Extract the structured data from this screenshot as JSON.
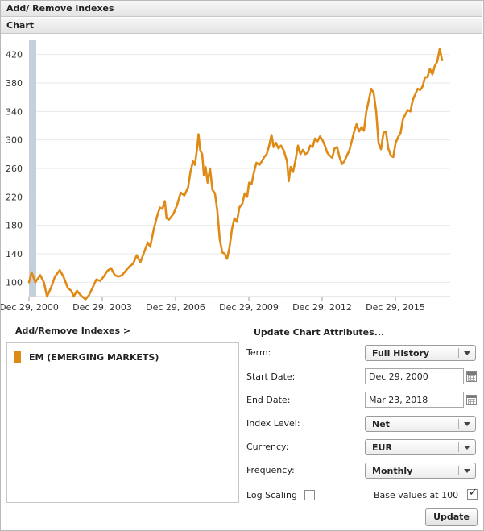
{
  "panel_title": "Add/ Remove indexes",
  "chart_header": "Chart",
  "colors": {
    "series": "#e08a16",
    "left_band": "#c4d0db",
    "grid": "#e9e9e9"
  },
  "chart_data": {
    "type": "line",
    "title": "",
    "xlabel": "",
    "ylabel": "",
    "ylim": [
      80,
      440
    ],
    "yticks": [
      100,
      140,
      180,
      220,
      260,
      300,
      340,
      380,
      420
    ],
    "xlim": [
      2000.99,
      2018.23
    ],
    "xticks": [
      {
        "pos": 2000.99,
        "label": "Dec 29, 2000"
      },
      {
        "pos": 2003.99,
        "label": "Dec 29, 2003"
      },
      {
        "pos": 2006.99,
        "label": "Dec 29, 2006"
      },
      {
        "pos": 2009.99,
        "label": "Dec 29, 2009"
      },
      {
        "pos": 2012.99,
        "label": "Dec 29, 2012"
      },
      {
        "pos": 2015.99,
        "label": "Dec 29, 2015"
      }
    ],
    "grid": true,
    "legend": "left",
    "series": [
      {
        "name": "EM (EMERGING MARKETS)",
        "points": [
          [
            2000.99,
            100
          ],
          [
            2001.1,
            114
          ],
          [
            2001.25,
            100
          ],
          [
            2001.45,
            110
          ],
          [
            2001.6,
            100
          ],
          [
            2001.73,
            80
          ],
          [
            2001.9,
            93
          ],
          [
            2002.05,
            108
          ],
          [
            2002.25,
            117
          ],
          [
            2002.4,
            108
          ],
          [
            2002.58,
            92
          ],
          [
            2002.72,
            88
          ],
          [
            2002.82,
            80
          ],
          [
            2002.95,
            88
          ],
          [
            2003.1,
            82
          ],
          [
            2003.3,
            76
          ],
          [
            2003.45,
            82
          ],
          [
            2003.6,
            93
          ],
          [
            2003.75,
            104
          ],
          [
            2003.9,
            102
          ],
          [
            2004.05,
            108
          ],
          [
            2004.2,
            116
          ],
          [
            2004.35,
            120
          ],
          [
            2004.5,
            110
          ],
          [
            2004.65,
            108
          ],
          [
            2004.8,
            110
          ],
          [
            2004.95,
            116
          ],
          [
            2005.1,
            122
          ],
          [
            2005.25,
            126
          ],
          [
            2005.4,
            138
          ],
          [
            2005.55,
            128
          ],
          [
            2005.7,
            142
          ],
          [
            2005.85,
            156
          ],
          [
            2005.95,
            150
          ],
          [
            2006.1,
            175
          ],
          [
            2006.25,
            195
          ],
          [
            2006.35,
            205
          ],
          [
            2006.45,
            203
          ],
          [
            2006.55,
            214
          ],
          [
            2006.62,
            190
          ],
          [
            2006.72,
            188
          ],
          [
            2006.9,
            196
          ],
          [
            2007.05,
            208
          ],
          [
            2007.2,
            226
          ],
          [
            2007.35,
            222
          ],
          [
            2007.5,
            233
          ],
          [
            2007.6,
            255
          ],
          [
            2007.7,
            270
          ],
          [
            2007.78,
            265
          ],
          [
            2007.88,
            290
          ],
          [
            2007.93,
            308
          ],
          [
            2008.0,
            285
          ],
          [
            2008.08,
            280
          ],
          [
            2008.15,
            250
          ],
          [
            2008.22,
            262
          ],
          [
            2008.3,
            240
          ],
          [
            2008.4,
            260
          ],
          [
            2008.5,
            230
          ],
          [
            2008.6,
            225
          ],
          [
            2008.7,
            200
          ],
          [
            2008.8,
            160
          ],
          [
            2008.9,
            142
          ],
          [
            2009.0,
            140
          ],
          [
            2009.1,
            133
          ],
          [
            2009.2,
            150
          ],
          [
            2009.3,
            175
          ],
          [
            2009.4,
            190
          ],
          [
            2009.5,
            185
          ],
          [
            2009.6,
            205
          ],
          [
            2009.72,
            210
          ],
          [
            2009.82,
            225
          ],
          [
            2009.92,
            220
          ],
          [
            2010.0,
            240
          ],
          [
            2010.1,
            238
          ],
          [
            2010.2,
            255
          ],
          [
            2010.3,
            268
          ],
          [
            2010.42,
            265
          ],
          [
            2010.52,
            270
          ],
          [
            2010.62,
            276
          ],
          [
            2010.72,
            280
          ],
          [
            2010.82,
            292
          ],
          [
            2010.92,
            307
          ],
          [
            2011.0,
            290
          ],
          [
            2011.1,
            296
          ],
          [
            2011.2,
            288
          ],
          [
            2011.3,
            292
          ],
          [
            2011.42,
            285
          ],
          [
            2011.55,
            270
          ],
          [
            2011.62,
            242
          ],
          [
            2011.7,
            262
          ],
          [
            2011.8,
            255
          ],
          [
            2011.9,
            272
          ],
          [
            2012.0,
            292
          ],
          [
            2012.1,
            280
          ],
          [
            2012.2,
            286
          ],
          [
            2012.3,
            280
          ],
          [
            2012.4,
            282
          ],
          [
            2012.5,
            292
          ],
          [
            2012.6,
            290
          ],
          [
            2012.7,
            302
          ],
          [
            2012.8,
            298
          ],
          [
            2012.9,
            305
          ],
          [
            2013.0,
            300
          ],
          [
            2013.1,
            292
          ],
          [
            2013.2,
            282
          ],
          [
            2013.3,
            278
          ],
          [
            2013.4,
            275
          ],
          [
            2013.5,
            288
          ],
          [
            2013.6,
            290
          ],
          [
            2013.7,
            276
          ],
          [
            2013.8,
            266
          ],
          [
            2013.9,
            270
          ],
          [
            2014.0,
            278
          ],
          [
            2014.1,
            285
          ],
          [
            2014.2,
            298
          ],
          [
            2014.3,
            312
          ],
          [
            2014.4,
            322
          ],
          [
            2014.5,
            312
          ],
          [
            2014.6,
            318
          ],
          [
            2014.7,
            313
          ],
          [
            2014.8,
            340
          ],
          [
            2014.9,
            356
          ],
          [
            2015.0,
            372
          ],
          [
            2015.1,
            366
          ],
          [
            2015.2,
            340
          ],
          [
            2015.3,
            295
          ],
          [
            2015.4,
            287
          ],
          [
            2015.5,
            310
          ],
          [
            2015.6,
            312
          ],
          [
            2015.7,
            288
          ],
          [
            2015.8,
            278
          ],
          [
            2015.9,
            276
          ],
          [
            2016.0,
            296
          ],
          [
            2016.1,
            304
          ],
          [
            2016.2,
            310
          ],
          [
            2016.3,
            330
          ],
          [
            2016.4,
            336
          ],
          [
            2016.5,
            342
          ],
          [
            2016.6,
            340
          ],
          [
            2016.7,
            356
          ],
          [
            2016.8,
            364
          ],
          [
            2016.9,
            372
          ],
          [
            2017.0,
            370
          ],
          [
            2017.1,
            375
          ],
          [
            2017.2,
            388
          ],
          [
            2017.3,
            388
          ],
          [
            2017.4,
            400
          ],
          [
            2017.5,
            392
          ],
          [
            2017.6,
            404
          ],
          [
            2017.7,
            410
          ],
          [
            2017.8,
            428
          ],
          [
            2017.9,
            412
          ]
        ]
      }
    ]
  },
  "indexes_title": "Add/Remove Indexes >",
  "legend_items": [
    {
      "label": "EM (EMERGING MARKETS)"
    }
  ],
  "attrs_title": "Update Chart Attributes...",
  "fields": {
    "term": {
      "label": "Term:",
      "value": "Full History"
    },
    "start_date": {
      "label": "Start Date:",
      "value": "Dec 29, 2000"
    },
    "end_date": {
      "label": "End Date:",
      "value": "Mar 23, 2018"
    },
    "index_level": {
      "label": "Index Level:",
      "value": "Net"
    },
    "currency": {
      "label": "Currency:",
      "value": "EUR"
    },
    "frequency": {
      "label": "Frequency:",
      "value": "Monthly"
    },
    "log_scaling": {
      "label": "Log Scaling",
      "checked": false
    },
    "base_values": {
      "label": "Base values at 100",
      "checked": true
    }
  },
  "update_label": "Update",
  "icons": {
    "dropdown": "chevron-down-icon",
    "calendar": "calendar-icon",
    "check": "checkmark-icon"
  }
}
